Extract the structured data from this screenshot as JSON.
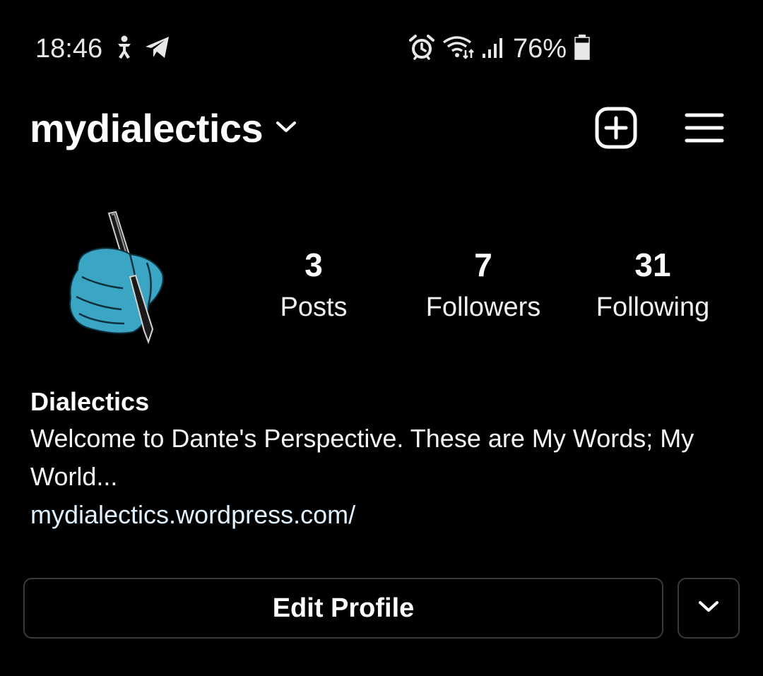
{
  "status_bar": {
    "time": "18:46",
    "battery_percent": "76%",
    "battery_level": 0.76,
    "icons": [
      "accessibility-icon",
      "telegram-icon",
      "alarm-icon",
      "wifi-icon",
      "signal-icon",
      "battery-icon"
    ]
  },
  "header": {
    "username": "mydialectics",
    "icons": [
      "chevron-down-icon",
      "add-post-icon",
      "menu-icon"
    ]
  },
  "profile": {
    "avatar_icon": "hand-writing-with-pen-icon",
    "avatar_color": "#3aa6c4",
    "stats": {
      "posts": {
        "value": "3",
        "label": "Posts"
      },
      "followers": {
        "value": "7",
        "label": "Followers"
      },
      "following": {
        "value": "31",
        "label": "Following"
      }
    }
  },
  "bio": {
    "name": "Dialectics",
    "text": "Welcome to Dante's Perspective.  These are My Words; My World...",
    "link": "mydialectics.wordpress.com/",
    "link_color": "#e0f1ff"
  },
  "actions": {
    "edit_profile_label": "Edit Profile",
    "suggest_icon": "chevron-down-icon"
  }
}
